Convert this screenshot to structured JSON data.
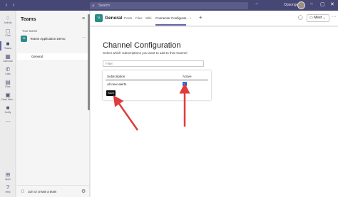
{
  "search": {
    "placeholder": "Search"
  },
  "top": {
    "org": "Opsonge",
    "more": "···",
    "min": "–",
    "max": "▢",
    "close": "✕"
  },
  "rail": [
    {
      "label": "Activity",
      "icon": "bell-icon",
      "glyph": "🔔"
    },
    {
      "label": "Chat",
      "icon": "chat-icon",
      "glyph": "💬"
    },
    {
      "label": "Teams",
      "icon": "teams-icon",
      "glyph": "👥"
    },
    {
      "label": "Calendar",
      "icon": "calendar-icon",
      "glyph": "▦"
    },
    {
      "label": "Calls",
      "icon": "phone-icon",
      "glyph": "✆"
    },
    {
      "label": "Files",
      "icon": "files-icon",
      "glyph": "▤"
    },
    {
      "label": "Class Web...",
      "icon": "app-icon",
      "glyph": "▣"
    },
    {
      "label": "Notify",
      "icon": "notify-icon",
      "glyph": "■"
    },
    {
      "label": "···",
      "icon": "more-apps-icon",
      "glyph": ""
    },
    {
      "label": "Apps",
      "icon": "apps-icon",
      "glyph": "⊞"
    },
    {
      "label": "Help",
      "icon": "help-icon",
      "glyph": "?"
    }
  ],
  "panel": {
    "title": "Teams",
    "section": "Your teams",
    "team": {
      "initials": "TA",
      "name": "Teams Application Demo",
      "more": "···"
    },
    "channel": "General",
    "join": "Join or create a team"
  },
  "header": {
    "initials": "TA",
    "title": "General",
    "tabs": [
      "Posts",
      "Files",
      "Wiki",
      "Connector Configurat..."
    ],
    "meet": "Meet"
  },
  "config": {
    "title": "Channel Configuration",
    "subtitle": "Select which subscriptions you want to add to this channel",
    "filter_placeholder": "Filter",
    "col_subscription": "Subscription",
    "col_active": "Active",
    "row_name": "All new alerts",
    "row_active": true,
    "save": "Save"
  },
  "colors": {
    "brand": "#6264a7",
    "arrow": "#e03c3c",
    "topbar": "#464775"
  }
}
